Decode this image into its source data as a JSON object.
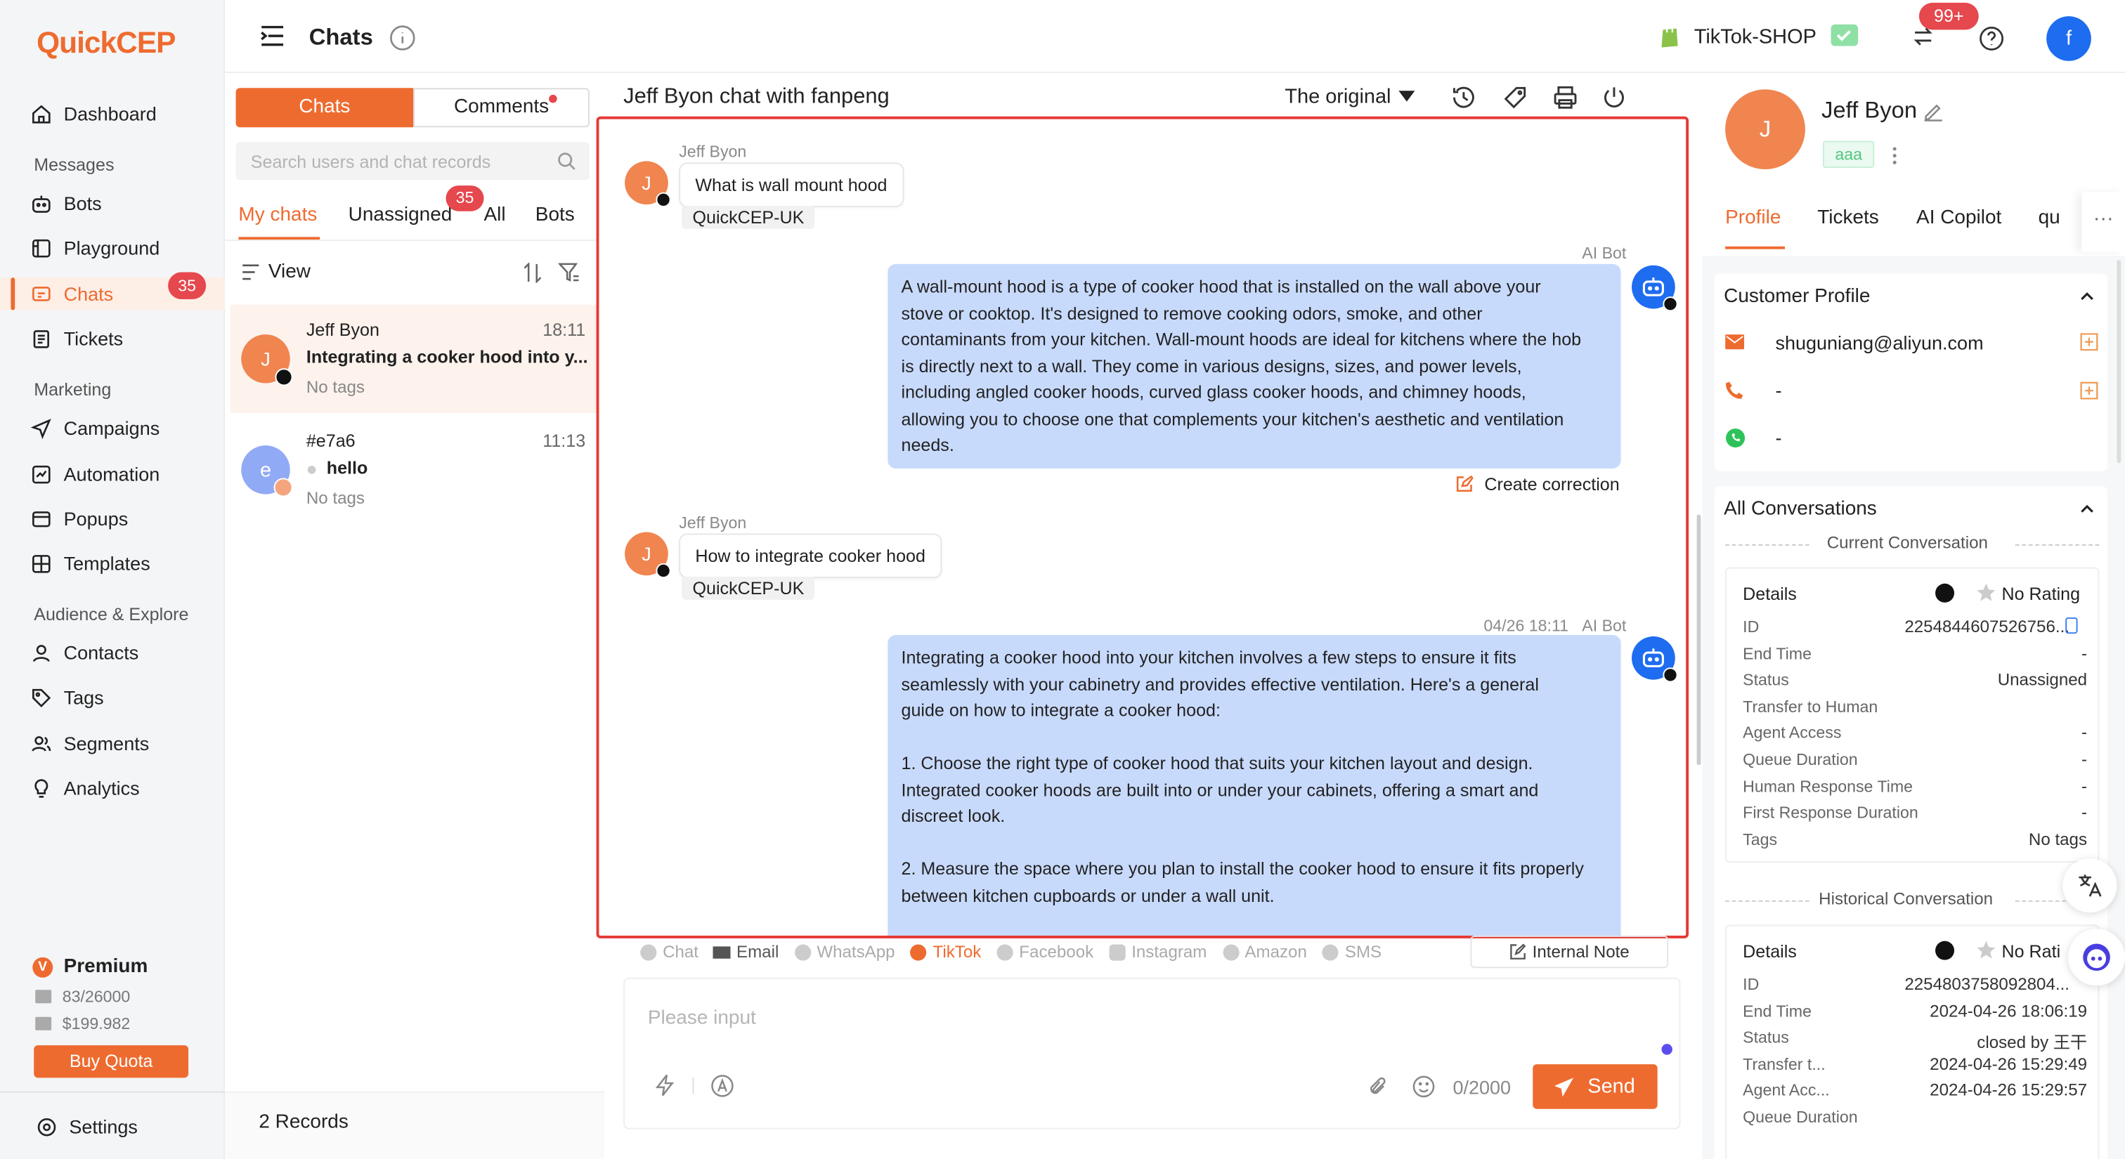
{
  "brand": {
    "logo": "QuickCEP",
    "accent": "#ee6b2f"
  },
  "nav": {
    "dashboard": "Dashboard",
    "messages_section": "Messages",
    "bots": "Bots",
    "playground": "Playground",
    "chats": "Chats",
    "chats_badge": "35",
    "tickets": "Tickets",
    "marketing_section": "Marketing",
    "campaigns": "Campaigns",
    "automation": "Automation",
    "popups": "Popups",
    "templates": "Templates",
    "audience_section": "Audience & Explore",
    "contacts": "Contacts",
    "tags": "Tags",
    "segments": "Segments",
    "analytics": "Analytics",
    "plan": "Premium",
    "quota_messages": "83/26000",
    "quota_money": "$199.982",
    "buy_quota": "Buy Quota",
    "settings": "Settings"
  },
  "header": {
    "title": "Chats",
    "shop": "TikTok-SHOP",
    "notif_badge": "99+",
    "user_initial": "f"
  },
  "list": {
    "tab_chats": "Chats",
    "tab_comments": "Comments",
    "search_placeholder": "Search users and chat records",
    "sub_my": "My chats",
    "sub_unassigned": "Unassigned",
    "unassigned_badge": "35",
    "sub_all": "All",
    "sub_bots": "Bots",
    "view": "View",
    "records": "2 Records",
    "items": [
      {
        "name": "Jeff Byon",
        "initial": "J",
        "time": "18:11",
        "preview": "Integrating a cooker hood into y...",
        "tags": "No tags"
      },
      {
        "name": "#e7a6",
        "initial": "e",
        "time": "11:13",
        "preview": "hello",
        "tags": "No tags"
      }
    ]
  },
  "chat": {
    "title": "Jeff Byon chat with fanpeng",
    "translate": "The original",
    "messages": [
      {
        "sender": "Jeff Byon",
        "text": "What is wall mount hood",
        "store": "QuickCEP-UK",
        "initial": "J"
      },
      {
        "sender": "AI Bot",
        "lines": [
          "A wall-mount hood is a type of cooker hood that is installed on the wall above your",
          "stove or cooktop. It's designed to remove cooking odors, smoke, and other",
          "contaminants from your kitchen. Wall-mount hoods are ideal for kitchens where the hob",
          "is directly next to a wall. They come in various designs, sizes, and power levels,",
          "including angled cooker hoods, curved glass cooker hoods, and chimney hoods,",
          "allowing you to choose one that complements your kitchen's aesthetic and ventilation",
          "needs."
        ],
        "correction": "Create correction"
      },
      {
        "sender": "Jeff Byon",
        "text": "How to integrate cooker hood",
        "store": "QuickCEP-UK",
        "initial": "J"
      },
      {
        "sender": "AI Bot",
        "time": "04/26 18:11",
        "lines": [
          "Integrating a cooker hood into your kitchen involves a few steps to ensure it fits",
          "seamlessly with your cabinetry and provides effective ventilation. Here's a general",
          "guide on how to integrate a cooker hood:",
          "",
          "1. Choose the right type of cooker hood that suits your kitchen layout and design.",
          "Integrated cooker hoods are built into or under your cabinets, offering a smart and",
          "discreet look.",
          "",
          "2. Measure the space where you plan to install the cooker hood to ensure it fits properly",
          "between kitchen cupboards or under a wall unit."
        ]
      }
    ],
    "channels": [
      "Chat",
      "Email",
      "WhatsApp",
      "TikTok",
      "Facebook",
      "Instagram",
      "Amazon",
      "SMS"
    ],
    "internal_note": "Internal Note",
    "input_placeholder": "Please input",
    "counter": "0/2000",
    "send": "Send"
  },
  "customer": {
    "name": "Jeff Byon",
    "initial": "J",
    "tag": "aaa",
    "tabs": [
      "Profile",
      "Tickets",
      "AI Copilot",
      "qu"
    ],
    "profile_title": "Customer Profile",
    "email": "shuguniang@aliyun.com",
    "phone": "-",
    "whatsapp": "-",
    "conv_title": "All Conversations",
    "current_label": "Current Conversation",
    "historical_label": "Historical Conversation",
    "current": {
      "details": "Details",
      "rating": "No Rating",
      "rows": [
        [
          "ID",
          "2254844607526756..."
        ],
        [
          "End Time",
          "-"
        ],
        [
          "Status",
          "Unassigned"
        ],
        [
          "Transfer to Human",
          ""
        ],
        [
          "Agent Access",
          "-"
        ],
        [
          "Queue Duration",
          "-"
        ],
        [
          "Human Response Time",
          "-"
        ],
        [
          "First Response Duration",
          "-"
        ],
        [
          "Tags",
          "No tags"
        ]
      ]
    },
    "historical": {
      "details": "Details",
      "rating": "No Rati",
      "rows": [
        [
          "ID",
          "2254803758092804..."
        ],
        [
          "End Time",
          "2024-04-26 18:06:19"
        ],
        [
          "Status",
          "closed by 王干"
        ],
        [
          "Transfer t...",
          "2024-04-26 15:29:49"
        ],
        [
          "Agent Acc...",
          "2024-04-26 15:29:57"
        ],
        [
          "Queue Duration",
          ""
        ]
      ]
    }
  }
}
